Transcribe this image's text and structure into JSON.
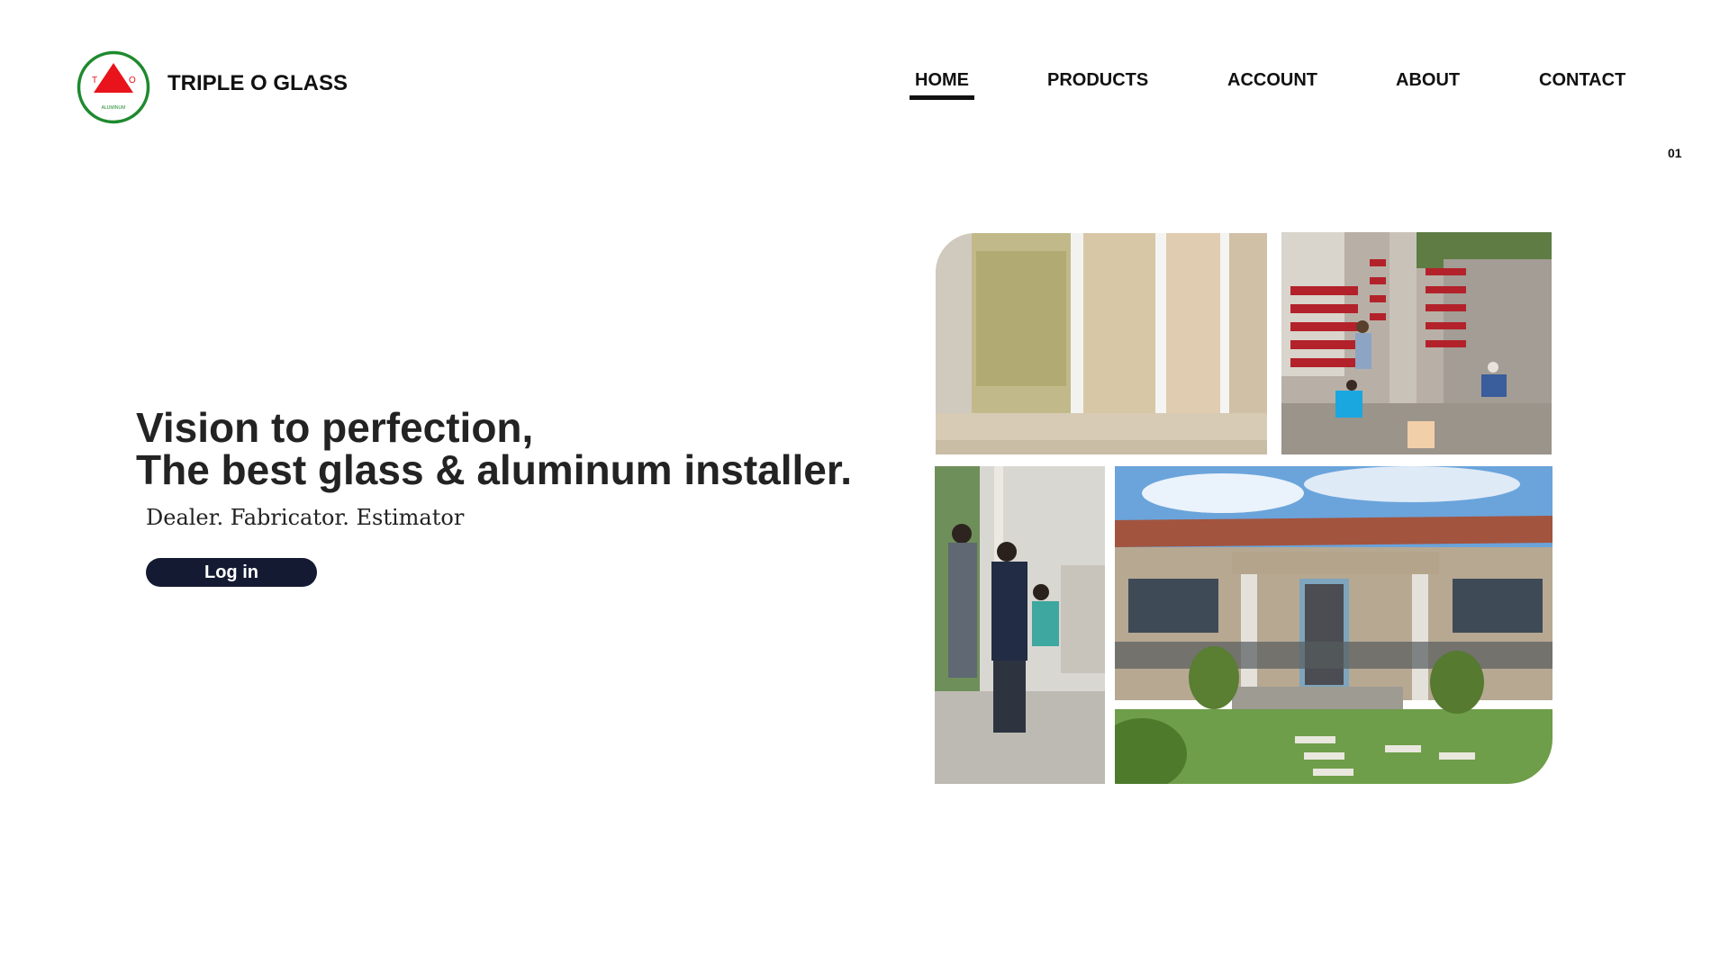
{
  "header": {
    "brand_name": "TRIPLE O GLASS",
    "logo": {
      "icon": "triangle-logo-icon",
      "letters": [
        "T",
        "O"
      ],
      "caption": "ALUMINUM",
      "ring_color": "#1e8a2e",
      "triangle_color": "#e8131b"
    },
    "nav": [
      {
        "label": "HOME",
        "active": true
      },
      {
        "label": "PRODUCTS",
        "active": false
      },
      {
        "label": "ACCOUNT",
        "active": false
      },
      {
        "label": "ABOUT",
        "active": false
      },
      {
        "label": "CONTACT",
        "active": false
      }
    ]
  },
  "page_indicator": "01",
  "hero": {
    "title_line1": "Vision to perfection,",
    "title_line2": "The best glass & aluminum installer.",
    "subtitle": "Dealer. Fabricator. Estimator",
    "login_label": "Log in",
    "login_color": "#141a31"
  },
  "gallery": [
    {
      "subject": "glass sliding doors"
    },
    {
      "subject": "workers installing red aluminum gate"
    },
    {
      "subject": "workers installing glass panels"
    },
    {
      "subject": "house with tiled roof and garden"
    }
  ]
}
